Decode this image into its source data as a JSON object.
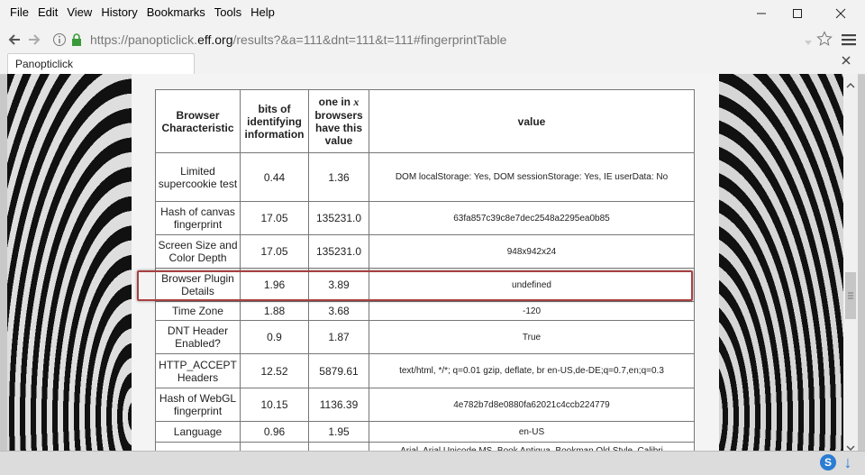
{
  "menu": [
    "File",
    "Edit",
    "View",
    "History",
    "Bookmarks",
    "Tools",
    "Help"
  ],
  "url": {
    "pre": "https://panopticlick.",
    "domain": "eff.org",
    "post": "/results?&a=111&dnt=111&t=111#fingerprintTable"
  },
  "tab": {
    "title": "Panopticlick"
  },
  "table": {
    "headers": {
      "c1": "Browser Characteristic",
      "c2": "bits of identifying information",
      "c3a": "one in ",
      "c3x": "x",
      "c3b": " browsers have this value",
      "c4": "value"
    },
    "rows": [
      {
        "name": "Limited supercookie test",
        "bits": "0.44",
        "one_in": "1.36",
        "value": "DOM localStorage: Yes, DOM sessionStorage: Yes, IE userData: No"
      },
      {
        "name": "Hash of canvas fingerprint",
        "bits": "17.05",
        "one_in": "135231.0",
        "value": "63fa857c39c8e7dec2548a2295ea0b85"
      },
      {
        "name": "Screen Size and Color Depth",
        "bits": "17.05",
        "one_in": "135231.0",
        "value": "948x942x24"
      },
      {
        "name": "Browser Plugin Details",
        "bits": "1.96",
        "one_in": "3.89",
        "value": "undefined"
      },
      {
        "name": "Time Zone",
        "bits": "1.88",
        "one_in": "3.68",
        "value": "-120"
      },
      {
        "name": "DNT Header Enabled?",
        "bits": "0.9",
        "one_in": "1.87",
        "value": "True"
      },
      {
        "name": "HTTP_ACCEPT Headers",
        "bits": "12.52",
        "one_in": "5879.61",
        "value": "text/html, */*; q=0.01 gzip, deflate, br en-US,de-DE;q=0.7,en;q=0.3"
      },
      {
        "name": "Hash of WebGL fingerprint",
        "bits": "10.15",
        "one_in": "1136.39",
        "value": "4e782b7d8e0880fa62021c4ccb224779"
      },
      {
        "name": "Language",
        "bits": "0.96",
        "one_in": "1.95",
        "value": "en-US"
      },
      {
        "name": "",
        "bits": "",
        "one_in": "",
        "value": "Arial, Arial Unicode MS, Book Antiqua, Bookman Old Style, Calibri"
      }
    ]
  },
  "status": {
    "s_label": "S",
    "download_label": "↓"
  },
  "colors": {
    "highlight": "#a84040",
    "accent": "#2b7cd3"
  }
}
